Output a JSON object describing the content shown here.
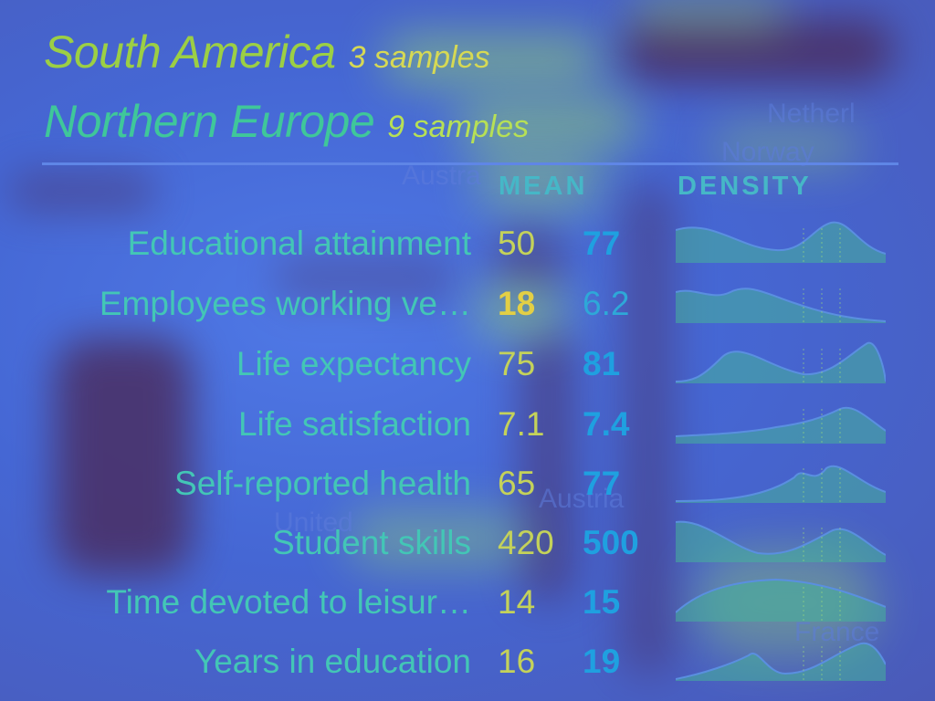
{
  "header": {
    "region_1": "South America",
    "region_1_samples": "3 samples",
    "region_2": "Northern Europe",
    "region_2_samples": "9 samples"
  },
  "columns": {
    "mean": "MEAN",
    "density": "DENSITY"
  },
  "rows": [
    {
      "label": "Educational attainment",
      "mean_1": "50",
      "mean_2": "77",
      "bold": "2"
    },
    {
      "label": "Employees working ve…",
      "mean_1": "18",
      "mean_2": "6.2",
      "bold": "1"
    },
    {
      "label": "Life expectancy",
      "mean_1": "75",
      "mean_2": "81",
      "bold": "2"
    },
    {
      "label": "Life satisfaction",
      "mean_1": "7.1",
      "mean_2": "7.4",
      "bold": "2"
    },
    {
      "label": "Self-reported health",
      "mean_1": "65",
      "mean_2": "77",
      "bold": "2"
    },
    {
      "label": "Student skills",
      "mean_1": "420",
      "mean_2": "500",
      "bold": "2"
    },
    {
      "label": "Time devoted to leisur…",
      "mean_1": "14",
      "mean_2": "15",
      "bold": "2"
    },
    {
      "label": "Years in education",
      "mean_1": "16",
      "mean_2": "19",
      "bold": "2"
    }
  ],
  "background_labels": [
    "Netherl",
    "Norway",
    "Austra",
    "Austria",
    "United",
    "France"
  ],
  "colors": {
    "accent": "#3fc79a",
    "density_fill": "#46b39a",
    "density_line": "#5a8fe0"
  }
}
